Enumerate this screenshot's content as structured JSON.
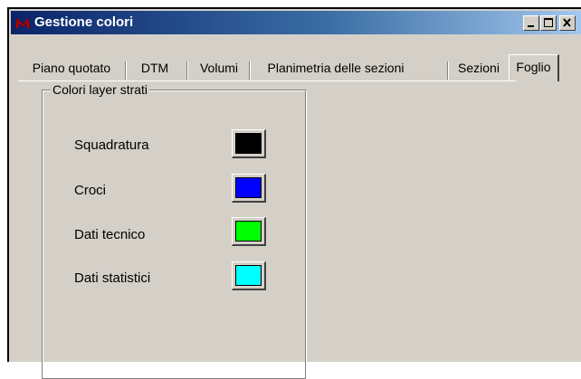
{
  "window": {
    "title": "Gestione colori",
    "icon": "red-m-app-icon",
    "buttons": [
      "minimize",
      "maximize",
      "close"
    ]
  },
  "tabs": [
    {
      "label": "Piano quotato",
      "active": false
    },
    {
      "label": "DTM",
      "active": false
    },
    {
      "label": "Volumi",
      "active": false
    },
    {
      "label": "Planimetria delle sezioni",
      "active": false
    },
    {
      "label": "Sezioni",
      "active": false
    },
    {
      "label": "Foglio",
      "active": true
    }
  ],
  "group": {
    "title": "Colori layer strati",
    "rows": [
      {
        "label": "Squadratura",
        "color": "#000000"
      },
      {
        "label": "Croci",
        "color": "#0000ff"
      },
      {
        "label": "Dati tecnico",
        "color": "#00ff00"
      },
      {
        "label": "Dati statistici",
        "color": "#00ffff"
      }
    ]
  }
}
